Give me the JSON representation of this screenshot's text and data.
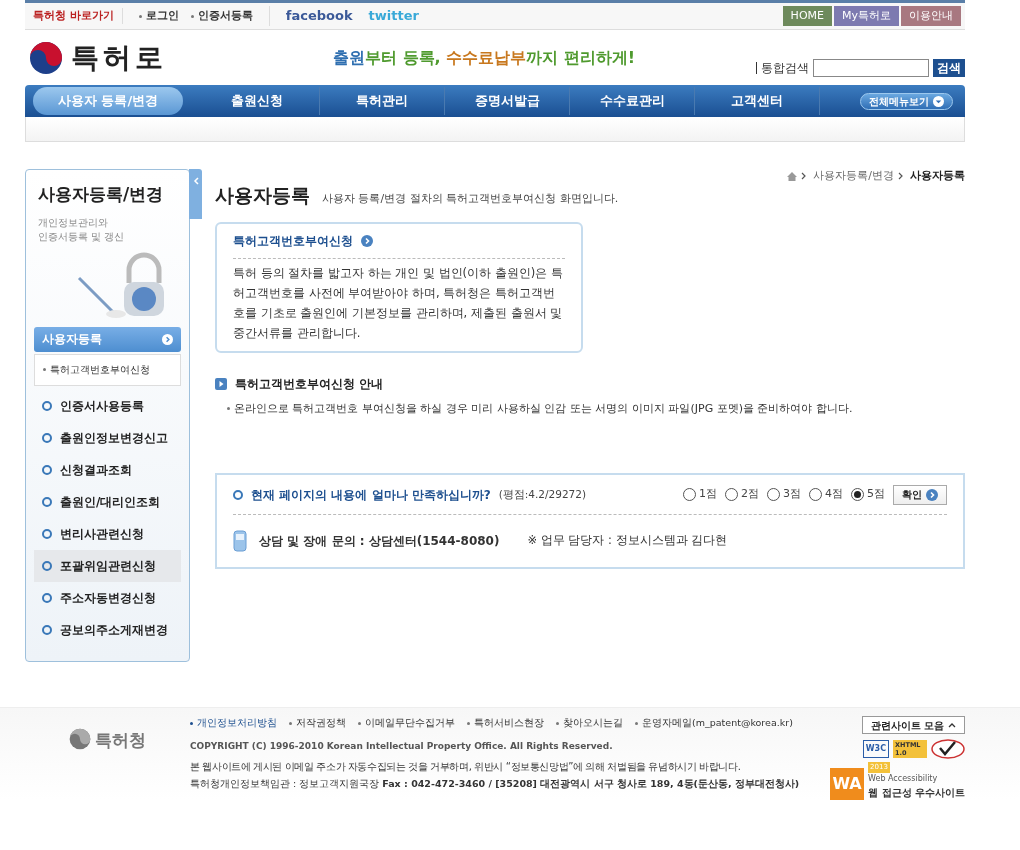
{
  "top_bar": {
    "shortcut": "특허청 바로가기",
    "links": [
      "로그인",
      "인증서등록"
    ],
    "social": [
      "facebook",
      "twitter"
    ],
    "buttons": [
      {
        "label": "HOME",
        "color": "#6e8a5c"
      },
      {
        "label": "My특허로",
        "color": "#7d7ab0"
      },
      {
        "label": "이용안내",
        "color": "#a87880"
      }
    ]
  },
  "header": {
    "logo": "특허로",
    "slogan": [
      {
        "text": "출원",
        "color": "#2f6fb0"
      },
      {
        "text": "부터 등록,",
        "color": "#4f9a2e"
      },
      {
        "text": " 수수료납부",
        "color": "#c8781e"
      },
      {
        "text": "까지 편리하게!",
        "color": "#4f9a2e"
      }
    ],
    "search_label": "통합검색",
    "search_button": "검색"
  },
  "nav": {
    "items": [
      {
        "label": "사용자 등록/변경",
        "selected": true
      },
      {
        "label": "출원신청",
        "selected": false
      },
      {
        "label": "특허관리",
        "selected": false
      },
      {
        "label": "증명서발급",
        "selected": false
      },
      {
        "label": "수수료관리",
        "selected": false
      },
      {
        "label": "고객센터",
        "selected": false
      }
    ],
    "all_menu": "전체메뉴보기"
  },
  "sidebar": {
    "title": "사용자등록/변경",
    "subtitle": [
      "개인정보관리와",
      "인증서등록 및 갱신"
    ],
    "section": "사용자등록",
    "sub_items": [
      "특허고객번호부여신청"
    ],
    "items": [
      {
        "label": "인증서사용등록",
        "selected": false
      },
      {
        "label": "출원인정보변경신고",
        "selected": false
      },
      {
        "label": "신청결과조회",
        "selected": false
      },
      {
        "label": "출원인/대리인조회",
        "selected": false
      },
      {
        "label": "변리사관련신청",
        "selected": false
      },
      {
        "label": "포괄위임관련신청",
        "selected": true
      },
      {
        "label": "주소자동변경신청",
        "selected": false
      },
      {
        "label": "공보의주소게재변경",
        "selected": false
      }
    ]
  },
  "breadcrumb": [
    "사용자등록/변경",
    "사용자등록"
  ],
  "page": {
    "title": "사용자등록",
    "description": "사용자 등록/변경 절차의 특허고객번호부여신청 화면입니다."
  },
  "info_box": {
    "title": "특허고객번호부여신청",
    "text": "특허 등의 절차를 밟고자 하는 개인 및 법인(이하 출원인)은 특허고객번호를 사전에 부여받아야 하며, 특허청은 특허고객번호를 기초로 출원인에 기본정보를 관리하며, 제출된 출원서 및 중간서류를 관리합니다."
  },
  "guide": {
    "heading": "특허고객번호부여신청 안내",
    "text": "온라인으로 특허고객번호 부여신청을 하실 경우 미리 사용하실 인감 또는 서명의 이미지 파일(JPG 포멧)을 준비하여야 합니다."
  },
  "survey": {
    "question": "현재 페이지의 내용에 얼마나 만족하십니까?",
    "score": "(평점:4.2/29272)",
    "options": [
      {
        "label": "1점",
        "selected": false
      },
      {
        "label": "2점",
        "selected": false
      },
      {
        "label": "3점",
        "selected": false
      },
      {
        "label": "4점",
        "selected": false
      },
      {
        "label": "5점",
        "selected": true
      }
    ],
    "confirm": "확인",
    "contact": "상담 및 장애 문의 : 상담센터(1544-8080)",
    "contact_note": "※ 업무 담당자 : 정보시스템과 김다현"
  },
  "footer": {
    "logo": "특허청",
    "links": [
      {
        "label": "개인정보처리방침",
        "current": true
      },
      {
        "label": "저작권정책",
        "current": false
      },
      {
        "label": "이메일무단수집거부",
        "current": false
      },
      {
        "label": "특허서비스현장",
        "current": false
      },
      {
        "label": "찾아오시는길",
        "current": false
      },
      {
        "label": "운영자메일(m_patent@korea.kr)",
        "current": false
      }
    ],
    "copyright": "COPYRIGHT (C) 1996-2010 Korean Intellectual Property Office. All Rights Reserved.",
    "notice": "본 웹사이트에 게시된 이메일 주소가 자동수집되는 것을 거부하며, 위반시 “정보통신망법”에 의해 처벌됨을 유념하시기 바랍니다.",
    "address": "특허청개인정보책임관 : 정보고객지원국장 **Fax : 042-472-3460 / [35208] 대전광역시 서구 청사로 189, 4동(둔산동, 정부대전청사)**",
    "related": "관련사이트 모음",
    "badges": {
      "w3c": "W3C",
      "xhtml": "XHTML 1.0",
      "wa": "WA",
      "wa_year": "2013",
      "wa_caption": "Web Accessibility",
      "wa_title": "웹 접근성 우수사이트"
    }
  }
}
